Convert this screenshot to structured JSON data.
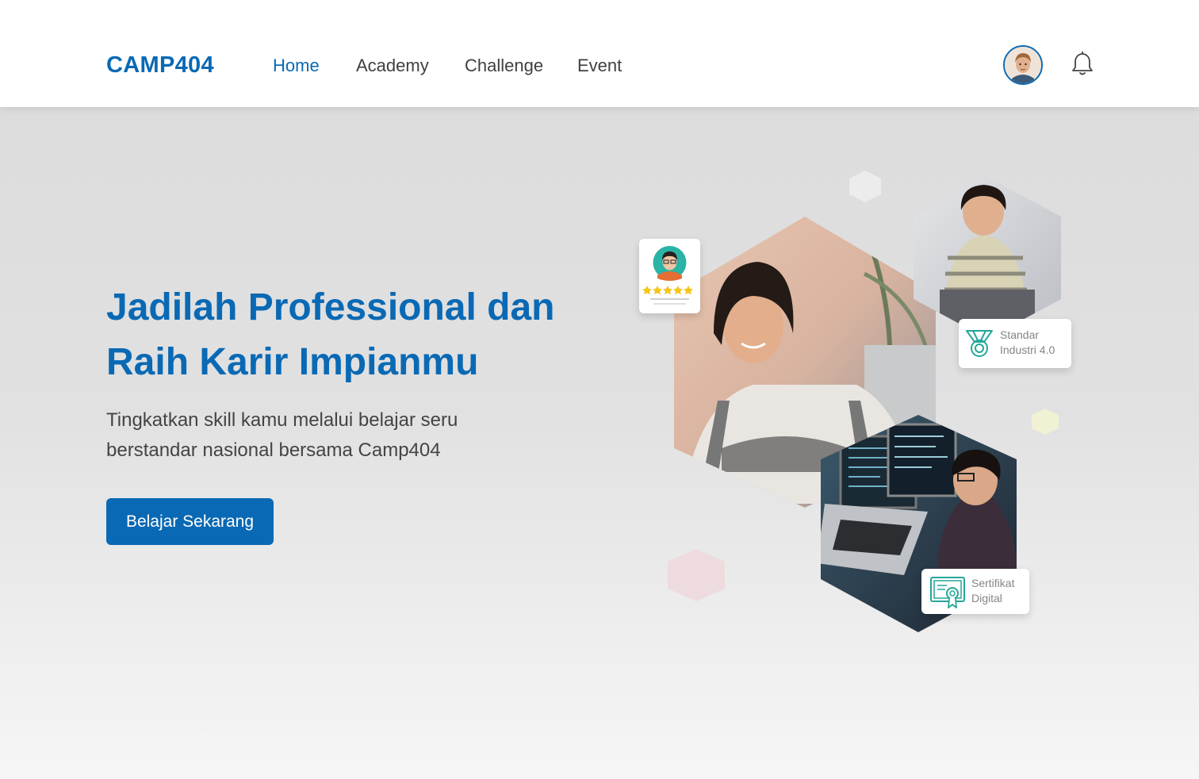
{
  "brand": {
    "logo": "CAMP404",
    "accent_color": "#0a69b4"
  },
  "nav": {
    "items": [
      {
        "label": "Home",
        "active": true
      },
      {
        "label": "Academy",
        "active": false
      },
      {
        "label": "Challenge",
        "active": false
      },
      {
        "label": "Event",
        "active": false
      }
    ],
    "avatar_icon": "user-avatar",
    "notification_icon": "bell-icon"
  },
  "hero": {
    "title_line1": "Jadilah Professional dan",
    "title_line2": "Raih Karir Impianmu",
    "subtitle_line1": "Tingkatkan skill kamu melalui belajar seru",
    "subtitle_line2": "berstandar nasional bersama Camp404",
    "cta_label": "Belajar Sekarang"
  },
  "badges": {
    "rating": {
      "icon": "reviewer-avatar",
      "stars": 5,
      "max_stars": 5
    },
    "standard": {
      "icon": "medal-icon",
      "line1": "Standar",
      "line2": "Industri 4.0"
    },
    "certificate": {
      "icon": "certificate-icon",
      "line1": "Sertifikat",
      "line2": "Digital"
    }
  }
}
